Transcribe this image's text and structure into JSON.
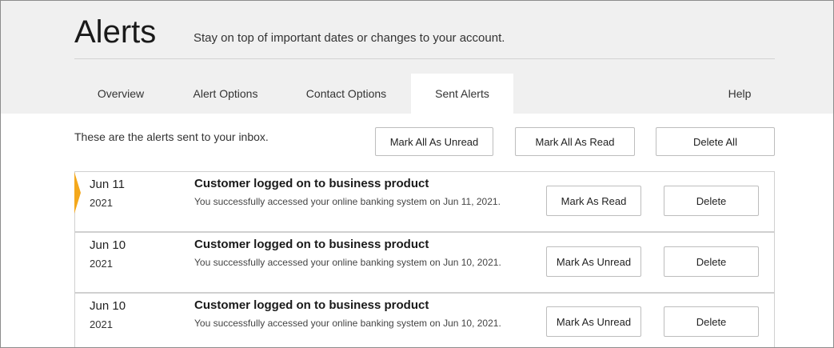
{
  "header": {
    "title": "Alerts",
    "subtitle": "Stay on top of important dates or changes to your account."
  },
  "tabs": [
    {
      "label": "Overview",
      "active": false
    },
    {
      "label": "Alert Options",
      "active": false
    },
    {
      "label": "Contact Options",
      "active": false
    },
    {
      "label": "Sent Alerts",
      "active": true
    },
    {
      "label": "Help",
      "active": false
    }
  ],
  "toolbar": {
    "intro": "These are the alerts sent to your inbox.",
    "mark_all_unread": "Mark All As Unread",
    "mark_all_read": "Mark All As Read",
    "delete_all": "Delete All"
  },
  "alerts": [
    {
      "day": "Jun 11",
      "year": "2021",
      "title": "Customer logged on to business product",
      "message": "You successfully accessed your online banking system on Jun 11, 2021.",
      "toggle_label": "Mark As Read",
      "delete_label": "Delete",
      "unread": true
    },
    {
      "day": "Jun 10",
      "year": "2021",
      "title": "Customer logged on to business product",
      "message": "You successfully accessed your online banking system on Jun 10, 2021.",
      "toggle_label": "Mark As Unread",
      "delete_label": "Delete",
      "unread": false
    },
    {
      "day": "Jun 10",
      "year": "2021",
      "title": "Customer logged on to business product",
      "message": "You successfully accessed your online banking system on Jun 10, 2021.",
      "toggle_label": "Mark As Unread",
      "delete_label": "Delete",
      "unread": false
    }
  ],
  "colors": {
    "header_bg": "#f0f0f0",
    "unread_marker": "#f4a81c",
    "border": "#d0d0d0"
  }
}
